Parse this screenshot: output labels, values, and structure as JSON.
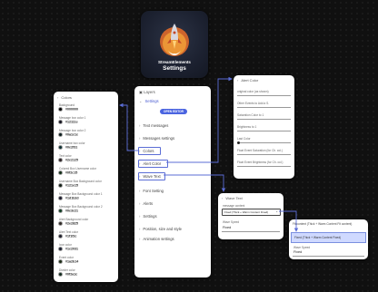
{
  "logo": {
    "brand": "StreamElements",
    "title": "Settings"
  },
  "colors_panel": {
    "title": "Colors",
    "items": [
      {
        "label": "Background",
        "value": "#000000"
      },
      {
        "label": "Message box color 1",
        "value": "#12111e"
      },
      {
        "label": "Message box color 2",
        "value": "#0a1c1c"
      },
      {
        "label": "Username box color",
        "value": "#0c2f31"
      },
      {
        "label": "Text color",
        "value": "#2c2125"
      },
      {
        "label": "Colored Box Username color",
        "value": "#0f2c15"
      },
      {
        "label": "Username Box Background color",
        "value": "#121e15"
      },
      {
        "label": "Message Box Background color 1",
        "value": "#1d1b2d"
      },
      {
        "label": "Message Box Background color 2",
        "value": "#0c3c21"
      },
      {
        "label": "Alert Background color",
        "value": "#2e2825"
      },
      {
        "label": "Alert Text color",
        "value": "#1f1f2c"
      },
      {
        "label": "Icon color",
        "value": "#1c2031"
      },
      {
        "label": "Event color",
        "value": "#1a2b14"
      },
      {
        "label": "Divider color",
        "value": "#0f2a1c"
      }
    ]
  },
  "main_panel": {
    "header": "Layers",
    "settings_label": "Settings",
    "open_editor": "OPEN EDITOR",
    "sections": [
      "Text messages",
      "Messages settings",
      "Colors",
      "Alert Color",
      "Wave Text",
      "Font Setting",
      "Alerts",
      "Settings",
      "Position, size and style",
      "Animation settings"
    ]
  },
  "alert_panel": {
    "title": "Alert Color",
    "fields": [
      "original color (as shown)",
      "Other Events to Add a S.",
      "Saturation Color to 1",
      "Brightness to 1",
      "Last Color",
      "Float Event Saturation (for Ch. col.)",
      "Float Event Brightness (for Ch. col.)"
    ]
  },
  "wave_panel": {
    "title": "Wave Text",
    "message_label": "message content",
    "message_value": "Fixed (Thick + Warm Content Fixed)",
    "speed_label": "Wave Speed",
    "speed_value": "Fixed"
  },
  "dropdown_panel": {
    "header": "Fit content (Thick + Warm Content Fit content)",
    "options": [
      "Fixed (Thick + Warm Content Fixed)",
      "Fixed"
    ]
  }
}
